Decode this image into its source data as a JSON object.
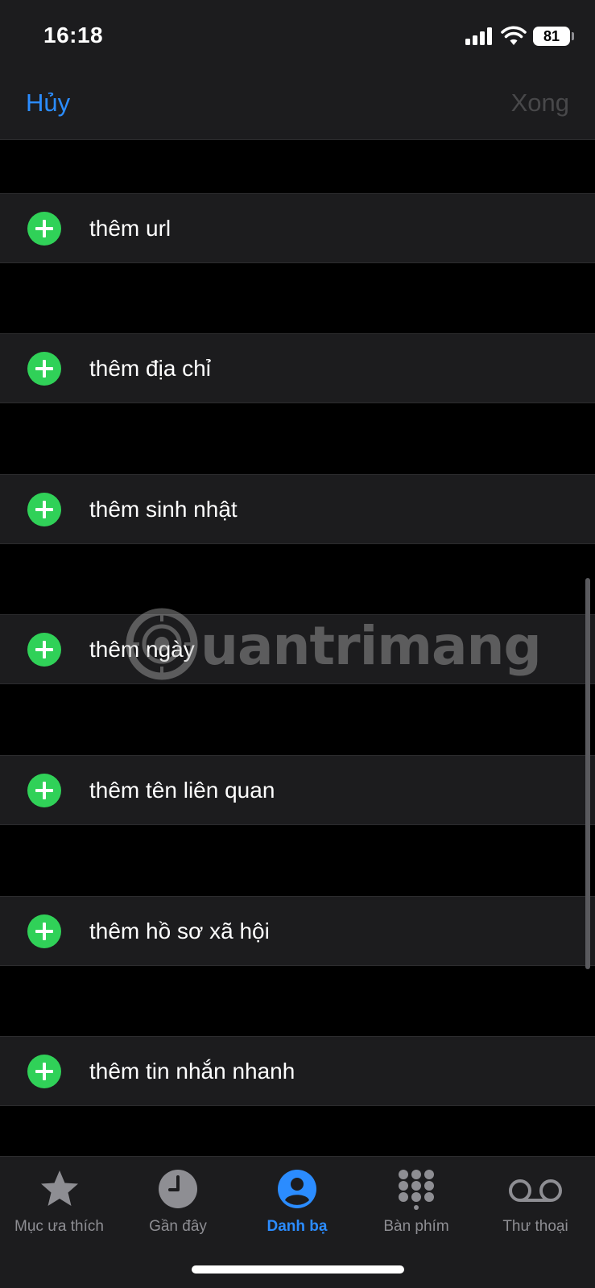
{
  "status_bar": {
    "time": "16:18",
    "battery": "81"
  },
  "nav": {
    "cancel_label": "Hủy",
    "done_label": "Xong"
  },
  "rows": [
    {
      "label": "thêm url"
    },
    {
      "label": "thêm địa chỉ"
    },
    {
      "label": "thêm sinh nhật"
    },
    {
      "label": "thêm ngày"
    },
    {
      "label": "thêm tên liên quan"
    },
    {
      "label": "thêm hồ sơ xã hội"
    },
    {
      "label": "thêm tin nhắn nhanh"
    }
  ],
  "watermark": {
    "text": "uantrimang"
  },
  "tabs": [
    {
      "label": "Mục ưa thích",
      "icon": "star-icon"
    },
    {
      "label": "Gần đây",
      "icon": "clock-icon"
    },
    {
      "label": "Danh bạ",
      "icon": "contact-icon"
    },
    {
      "label": "Bàn phím",
      "icon": "keypad-icon"
    },
    {
      "label": "Thư thoại",
      "icon": "voicemail-icon"
    }
  ],
  "colors": {
    "accent": "#2b8cff",
    "add_green": "#30d158",
    "row_bg": "#1c1c1e",
    "inactive": "#8e8e93"
  }
}
